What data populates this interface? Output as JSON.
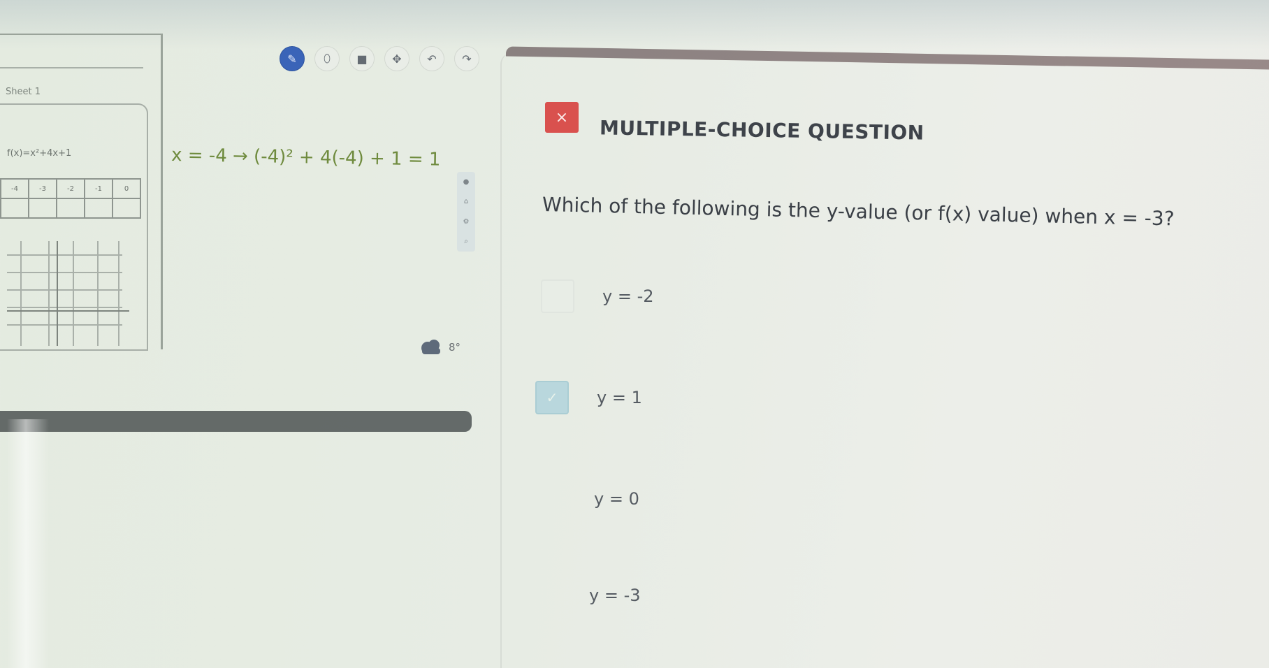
{
  "left_panel": {
    "sheet_label": "Sheet 1",
    "equation_preview": "f(x)=x²+4x+1",
    "table_headers": [
      "-4",
      "-3",
      "-2",
      "-1",
      "0"
    ]
  },
  "toolbar": {
    "tools": [
      {
        "name": "pen-tool",
        "glyph": "✎",
        "active": true
      },
      {
        "name": "eraser-tool",
        "glyph": "⬯"
      },
      {
        "name": "shape-tool",
        "glyph": "■"
      },
      {
        "name": "move-tool",
        "glyph": "✥"
      },
      {
        "name": "undo",
        "glyph": "↶"
      },
      {
        "name": "redo",
        "glyph": "↷"
      }
    ]
  },
  "handwriting": {
    "work": "x = -4 → (-4)² + 4(-4) + 1 = 1"
  },
  "weather": {
    "temperature": "8°"
  },
  "question": {
    "close_glyph": "×",
    "type_label": "MULTIPLE-CHOICE QUESTION",
    "prompt": "Which of the following is the y-value (or f(x) value) when x = -3?",
    "options": [
      {
        "label": "y = -2",
        "checked": false,
        "show_box": true
      },
      {
        "label": "y = 1",
        "checked": true,
        "show_box": true
      },
      {
        "label": "y = 0",
        "checked": false,
        "show_box": false
      },
      {
        "label": "y = -3",
        "checked": false,
        "show_box": false
      }
    ],
    "check_glyph": "✓"
  },
  "colors": {
    "accent": "#3a64b8",
    "close": "#d9514e",
    "checked": "#b9d7dd",
    "handwriting": "#6f8b3e"
  }
}
